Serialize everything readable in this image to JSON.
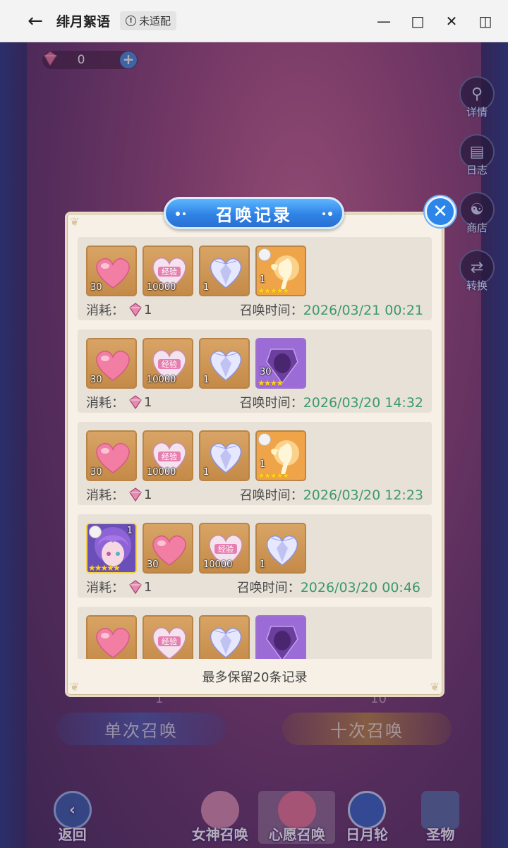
{
  "window": {
    "title": "绯月絮语",
    "badge": "未适配",
    "controls": [
      "minimize",
      "maximize",
      "close",
      "sidebar"
    ]
  },
  "currency": {
    "value": "0"
  },
  "side_buttons": [
    {
      "label": "详情",
      "icon": "magnifier-icon"
    },
    {
      "label": "日志",
      "icon": "book-icon"
    },
    {
      "label": "商店",
      "icon": "shop-icon"
    },
    {
      "label": "转换",
      "icon": "swap-icon"
    }
  ],
  "summon": {
    "single_label": "单次召唤",
    "ten_label": "十次召唤",
    "single_cost": "1",
    "ten_cost": "10"
  },
  "bottom_nav": {
    "back": "返回",
    "items": [
      "女神召唤",
      "心愿召唤",
      "日月轮",
      "圣物"
    ]
  },
  "modal": {
    "title": "召唤记录",
    "footer": "最多保留20条记录",
    "cost_label": "消耗：",
    "time_label": "召唤时间：",
    "records": [
      {
        "items": [
          {
            "kind": "pink-heart",
            "qty": "30"
          },
          {
            "kind": "exp-heart",
            "qty": "10000"
          },
          {
            "kind": "crystal-heart",
            "qty": "1"
          },
          {
            "kind": "fairy",
            "qty": "1",
            "stars": "★★★★★"
          }
        ],
        "cost": "1",
        "time": "2026/03/21 00:21"
      },
      {
        "items": [
          {
            "kind": "pink-heart",
            "qty": "30"
          },
          {
            "kind": "exp-heart",
            "qty": "10000"
          },
          {
            "kind": "crystal-heart",
            "qty": "1"
          },
          {
            "kind": "purple-gem",
            "qty": "30",
            "stars": "★★★★"
          }
        ],
        "cost": "1",
        "time": "2026/03/20 14:32"
      },
      {
        "items": [
          {
            "kind": "pink-heart",
            "qty": "30"
          },
          {
            "kind": "exp-heart",
            "qty": "10000"
          },
          {
            "kind": "crystal-heart",
            "qty": "1"
          },
          {
            "kind": "fairy",
            "qty": "1",
            "stars": "★★★★★"
          }
        ],
        "cost": "1",
        "time": "2026/03/20 12:23"
      },
      {
        "items": [
          {
            "kind": "character",
            "qty": "1",
            "stars": "★★★★★"
          },
          {
            "kind": "pink-heart",
            "qty": "30"
          },
          {
            "kind": "exp-heart",
            "qty": "10000"
          },
          {
            "kind": "crystal-heart",
            "qty": "1"
          }
        ],
        "cost": "1",
        "time": "2026/03/20 00:46"
      },
      {
        "items": [
          {
            "kind": "pink-heart",
            "qty": ""
          },
          {
            "kind": "exp-heart",
            "qty": ""
          },
          {
            "kind": "crystal-heart",
            "qty": ""
          },
          {
            "kind": "purple-gem",
            "qty": ""
          }
        ],
        "cost": "",
        "time": ""
      }
    ]
  },
  "colors": {
    "title_blue": "#2f83e6",
    "time_green": "#3b9a6a",
    "item_bg": "#d8a465",
    "star_gold": "#ffd21a"
  }
}
